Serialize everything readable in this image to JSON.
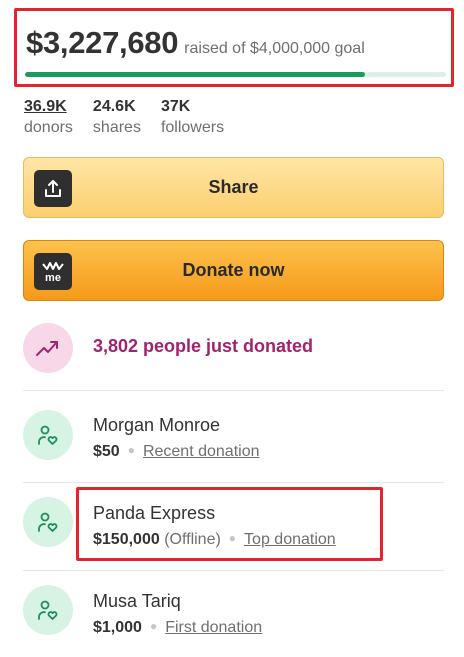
{
  "fundraiser": {
    "amount_raised": "$3,227,680",
    "goal_text": "raised of $4,000,000 goal",
    "progress_fraction": 0.807
  },
  "stats": [
    {
      "value": "36.9K",
      "label": "donors"
    },
    {
      "value": "24.6K",
      "label": "shares"
    },
    {
      "value": "37K",
      "label": "followers"
    }
  ],
  "buttons": {
    "share_label": "Share",
    "donate_label": "Donate now",
    "donate_icon_text": "me"
  },
  "activity": {
    "just_donated_text": "3,802 people just donated"
  },
  "donations": [
    {
      "name": "Morgan Monroe",
      "amount": "$50",
      "note": "",
      "tag": "Recent donation"
    },
    {
      "name": "Panda Express",
      "amount": "$150,000",
      "note": "(Offline)",
      "tag": "Top donation"
    },
    {
      "name": "Musa Tariq",
      "amount": "$1,000",
      "note": "",
      "tag": "First donation"
    }
  ],
  "colors": {
    "progress": "#1d9a5f",
    "highlight_border": "#e0262d",
    "just_donated": "#a3226e",
    "donate_button": "#f7a62a",
    "share_button": "#fcd98a"
  }
}
